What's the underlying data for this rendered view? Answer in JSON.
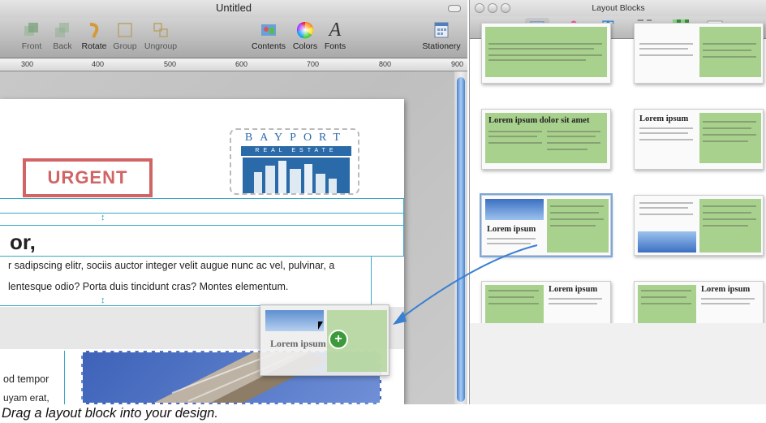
{
  "main_window": {
    "title": "Untitled",
    "toolbar": {
      "front": "Front",
      "back": "Back",
      "rotate": "Rotate",
      "group": "Group",
      "ungroup": "Ungroup",
      "contents": "Contents",
      "colors": "Colors",
      "fonts": "Fonts",
      "fonts_glyph": "A",
      "stationery": "Stationery"
    },
    "ruler_ticks": [
      "300",
      "400",
      "500",
      "600",
      "700",
      "800",
      "900"
    ],
    "document": {
      "stamp_text": "URGENT",
      "logo_name": "BAYPORT",
      "logo_sub": "REAL ESTATE",
      "heading": "or,",
      "body_line_1": "r sadipscing elitr, sociis auctor integer velit augue nunc ac vel, pulvinar, a",
      "body_line_2": "lentesque odio? Porta duis tincidunt cras? Montes elementum.",
      "lower_line_1": "od tempor",
      "lower_line_2": "uyam erat,",
      "ghost_heading": "Lorem ipsum"
    }
  },
  "layout_panel": {
    "title": "Layout Blocks",
    "block_headings": {
      "b3": "Lorem ipsum dolor sit amet",
      "b4": "Lorem ipsum",
      "b5": "Lorem ipsum",
      "b7": "Lorem ipsum",
      "b8": "Lorem ipsum"
    }
  },
  "caption": "Drag a layout block into your design.",
  "colors": {
    "block_green": "#a9d18e",
    "guide_cyan": "#3aa8c6",
    "stamp_red": "#c94a4a",
    "logo_blue": "#2a6aa9",
    "arrow_blue": "#3b7fd1"
  }
}
